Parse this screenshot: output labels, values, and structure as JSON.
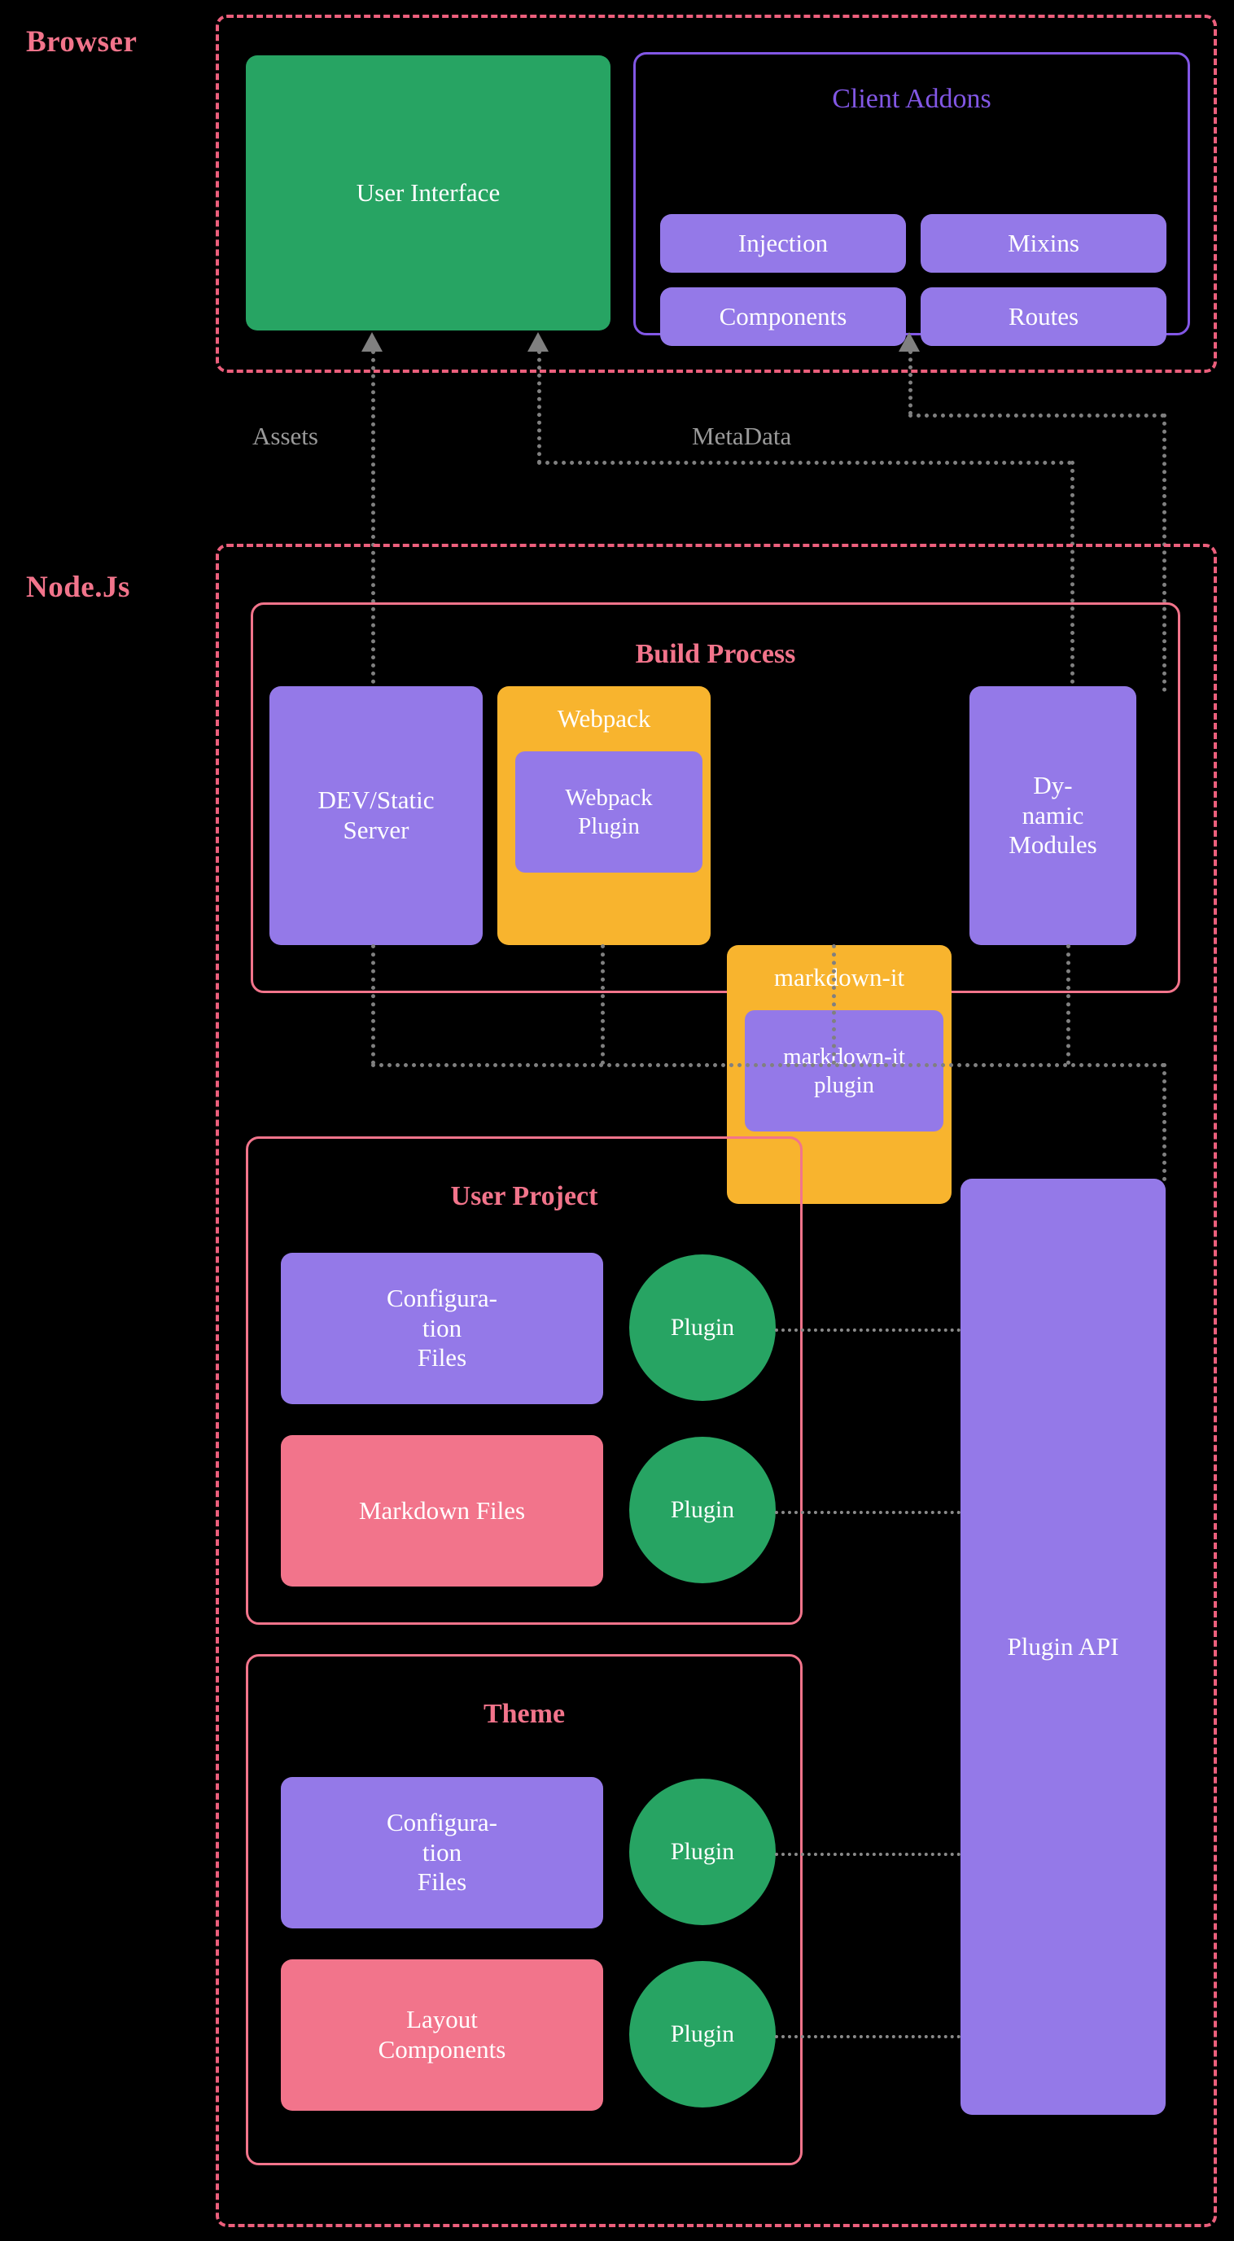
{
  "zones": {
    "browser": {
      "label": "Browser"
    },
    "nodejs": {
      "label": "Node.Js"
    }
  },
  "browser": {
    "user_interface": {
      "label": "User Interface",
      "color": "#27a463"
    },
    "client_addons": {
      "title": "Client Addons",
      "border_color": "#8257e5",
      "items": [
        {
          "label": "Injection"
        },
        {
          "label": "Mixins"
        },
        {
          "label": "Components"
        },
        {
          "label": "Routes"
        }
      ]
    }
  },
  "edges": {
    "assets_label": "Assets",
    "metadata_label": "MetaData"
  },
  "build_process": {
    "title": "Build Process",
    "boxes": [
      {
        "label": "DEV/Static Server",
        "color": "#9479e8",
        "type": "plain"
      },
      {
        "label": "Webpack",
        "color": "#f8b42e",
        "type": "stack",
        "inner": "Webpack Plugin"
      },
      {
        "label": "markdown-it",
        "color": "#f8b42e",
        "type": "stack",
        "inner": "markdown-it plugin"
      },
      {
        "label": "Dy- namic Modules",
        "color": "#9479e8",
        "type": "plain"
      }
    ]
  },
  "user_project": {
    "title": "User Project",
    "rows": [
      {
        "label": "Configura- tion Files",
        "color": "#9479e8",
        "plugin": "Plugin"
      },
      {
        "label": "Markdown Files",
        "color": "#f2748b",
        "plugin": "Plugin"
      }
    ]
  },
  "theme": {
    "title": "Theme",
    "rows": [
      {
        "label": "Configura- tion Files",
        "color": "#9479e8",
        "plugin": "Plugin"
      },
      {
        "label": "Layout Components",
        "color": "#f2748b",
        "plugin": "Plugin"
      }
    ]
  },
  "plugin_api": {
    "label": "Plugin API",
    "color": "#9479e8"
  },
  "colors": {
    "background": "#000000",
    "green": "#27a463",
    "purple": "#9479e8",
    "purple_border": "#8257e5",
    "pink": "#f2748b",
    "pink_dash": "#ec5f7c",
    "orange": "#f8b42e",
    "connector_gray": "#808080"
  }
}
